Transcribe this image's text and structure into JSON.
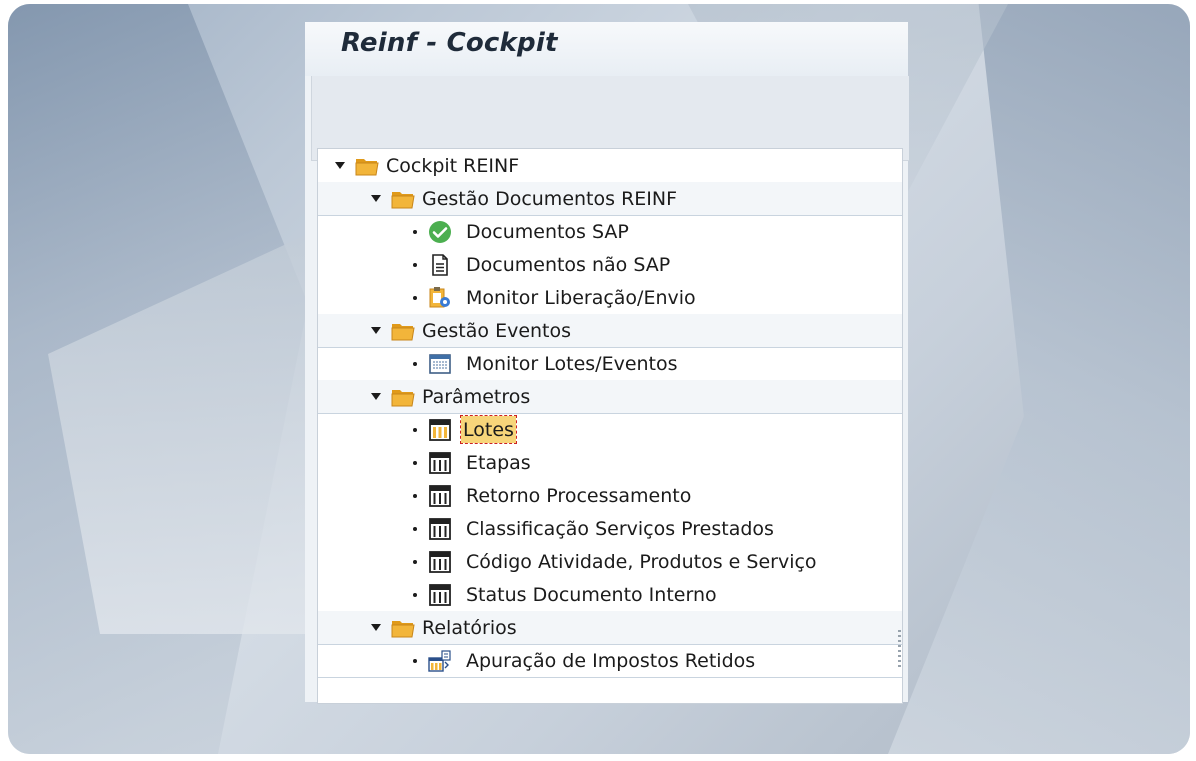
{
  "window": {
    "title": "Reinf - Cockpit"
  },
  "tree": {
    "root": "Cockpit REINF",
    "groups": [
      {
        "label": "Gestão Documentos REINF",
        "items": [
          "Documentos SAP",
          "Documentos não SAP",
          "Monitor Liberação/Envio"
        ]
      },
      {
        "label": "Gestão Eventos",
        "items": [
          "Monitor Lotes/Eventos"
        ]
      },
      {
        "label": "Parâmetros",
        "items": [
          "Lotes",
          "Etapas",
          "Retorno Processamento",
          "Classificação Serviços Prestados",
          "Código Atividade, Produtos e Serviço",
          "Status Documento Interno"
        ]
      },
      {
        "label": "Relatórios",
        "items": [
          "Apuração de Impostos Retidos"
        ]
      }
    ]
  },
  "icons": {
    "folder": "folder-open-icon",
    "check": "check-circle-icon",
    "document": "document-icon",
    "monitor": "monitor-gear-icon",
    "window": "window-list-icon",
    "table": "table-icon",
    "report": "report-table-icon"
  },
  "colors": {
    "folder": "#f2b53a",
    "check": "#4caf50",
    "selected": "#f7d57a",
    "title": "#1f2b3a"
  }
}
